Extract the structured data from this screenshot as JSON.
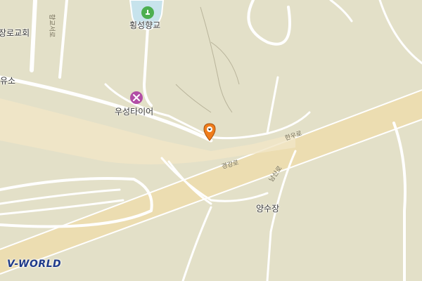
{
  "labels": {
    "church": "장로교회",
    "gas_station": "유소",
    "hyanggyo": "횡성향교",
    "tire_shop": "우성타이어",
    "place": "양수장"
  },
  "roads": {
    "vertical": "향교서로",
    "hanuro": "한우로",
    "gyeonggang": "경강로",
    "namsanro": "남산로"
  },
  "poi_icons": {
    "hyanggyo": "landmark-icon",
    "tire_shop": "repair-shop-icon",
    "marker": "location-pin-icon"
  },
  "colors": {
    "land": "#e3e0c8",
    "road_fill": "#f1e6c7",
    "road_outline": "#ffffff",
    "highway": "#efdcaa",
    "water": "#c7e3ec",
    "park": "#b7d5ad",
    "landmark_icon_bg": "#4caf50",
    "repair_icon_bg": "#b24ea6",
    "marker": "#f07d1b",
    "logo_text": "#1e3a8a"
  },
  "brand": {
    "logo": "V-WORLD"
  }
}
